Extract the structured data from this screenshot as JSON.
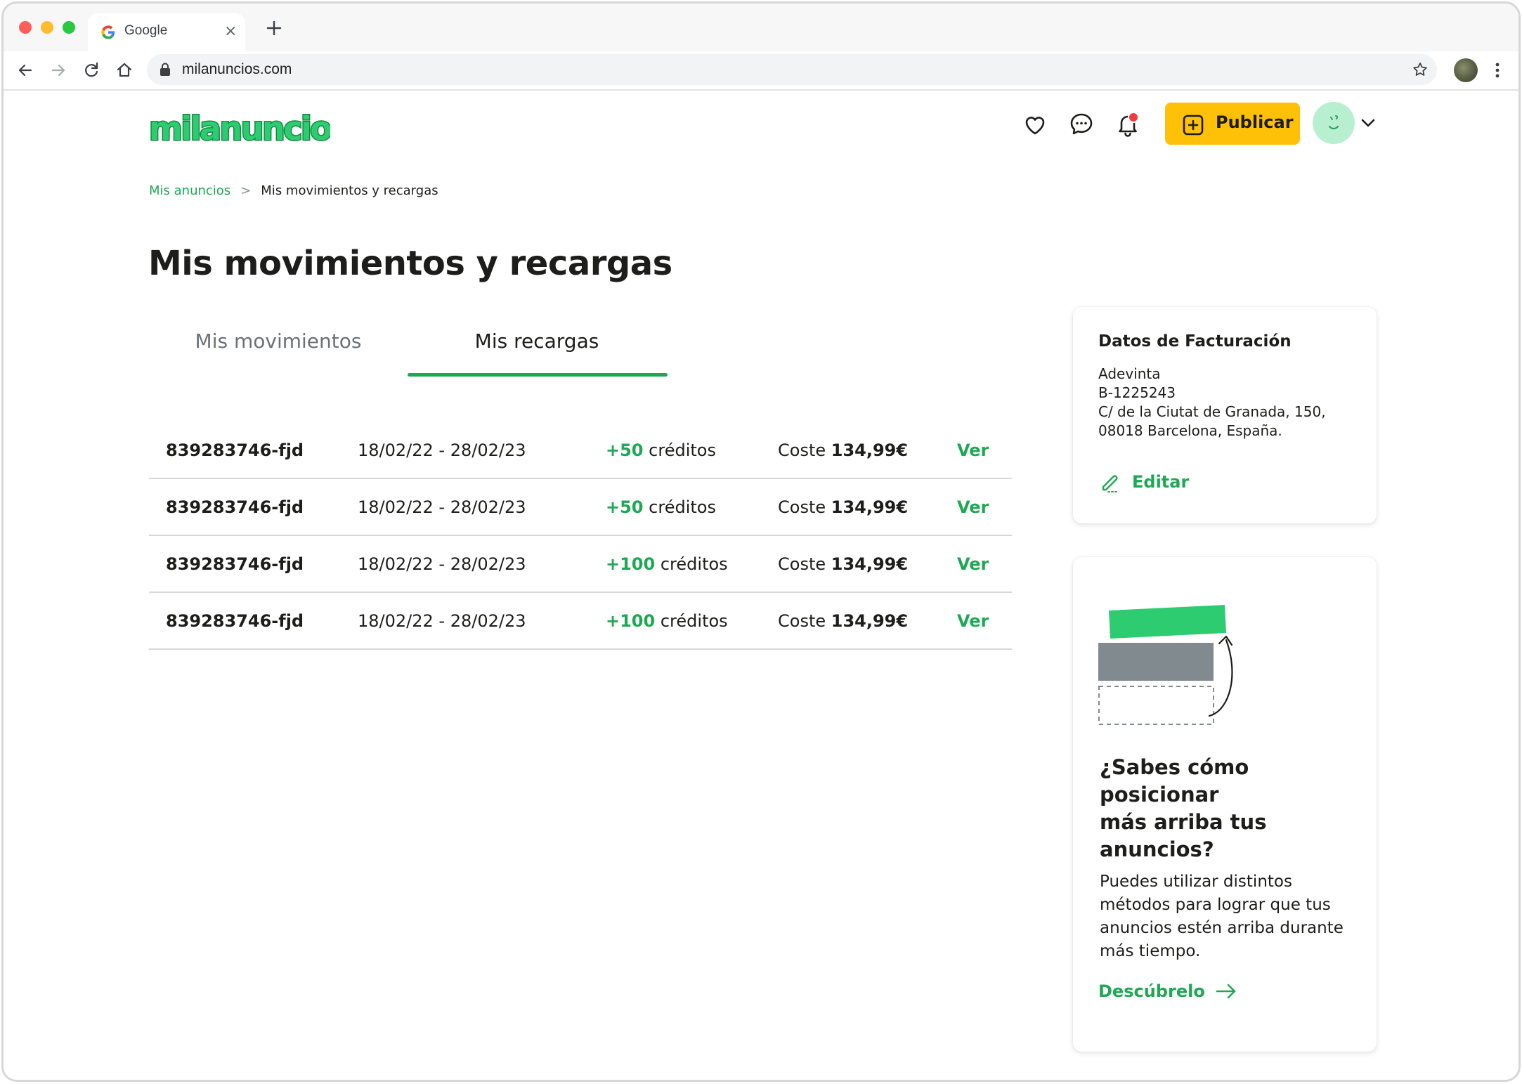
{
  "browser": {
    "tab_title": "Google",
    "url": "milanuncios.com"
  },
  "header": {
    "logo_text": "milanuncios",
    "publish_label": "Publicar",
    "has_notification": true
  },
  "breadcrumb": {
    "parent": "Mis anuncios",
    "separator": ">",
    "current": "Mis movimientos y recargas"
  },
  "page_title": "Mis movimientos y recargas",
  "tabs": [
    {
      "label": "Mis movimientos",
      "active": false
    },
    {
      "label": "Mis recargas",
      "active": true
    }
  ],
  "recharges": [
    {
      "id": "839283746-fjd",
      "period": "18/02/22 - 28/02/23",
      "credits_amount": "+50",
      "credits_unit": "créditos",
      "cost_label": "Coste",
      "cost_value": "134,99€",
      "action": "Ver"
    },
    {
      "id": "839283746-fjd",
      "period": "18/02/22 - 28/02/23",
      "credits_amount": "+50",
      "credits_unit": "créditos",
      "cost_label": "Coste",
      "cost_value": "134,99€",
      "action": "Ver"
    },
    {
      "id": "839283746-fjd",
      "period": "18/02/22 - 28/02/23",
      "credits_amount": "+100",
      "credits_unit": "créditos",
      "cost_label": "Coste",
      "cost_value": "134,99€",
      "action": "Ver"
    },
    {
      "id": "839283746-fjd",
      "period": "18/02/22 - 28/02/23",
      "credits_amount": "+100",
      "credits_unit": "créditos",
      "cost_label": "Coste",
      "cost_value": "134,99€",
      "action": "Ver"
    }
  ],
  "billing": {
    "title": "Datos de Facturación",
    "company": "Adevinta",
    "tax_id": "B-1225243",
    "address_line1": "C/ de la Ciutat de Granada, 150,",
    "address_line2": "08018 Barcelona, España.",
    "edit_label": "Editar"
  },
  "promo": {
    "title_lines": [
      "¿Sabes cómo",
      "posicionar",
      "más arriba tus",
      "anuncios?"
    ],
    "text": "Puedes utilizar distintos métodos para lograr que tus anuncios estén arriba durante más tiempo.",
    "link_label": "Descúbrelo"
  },
  "colors": {
    "brand_green": "#1ea854",
    "publish_yellow": "#ffc107",
    "notification_red": "#f23b3b",
    "text_dark": "#1d1d1b",
    "text_muted": "#6b7177"
  }
}
